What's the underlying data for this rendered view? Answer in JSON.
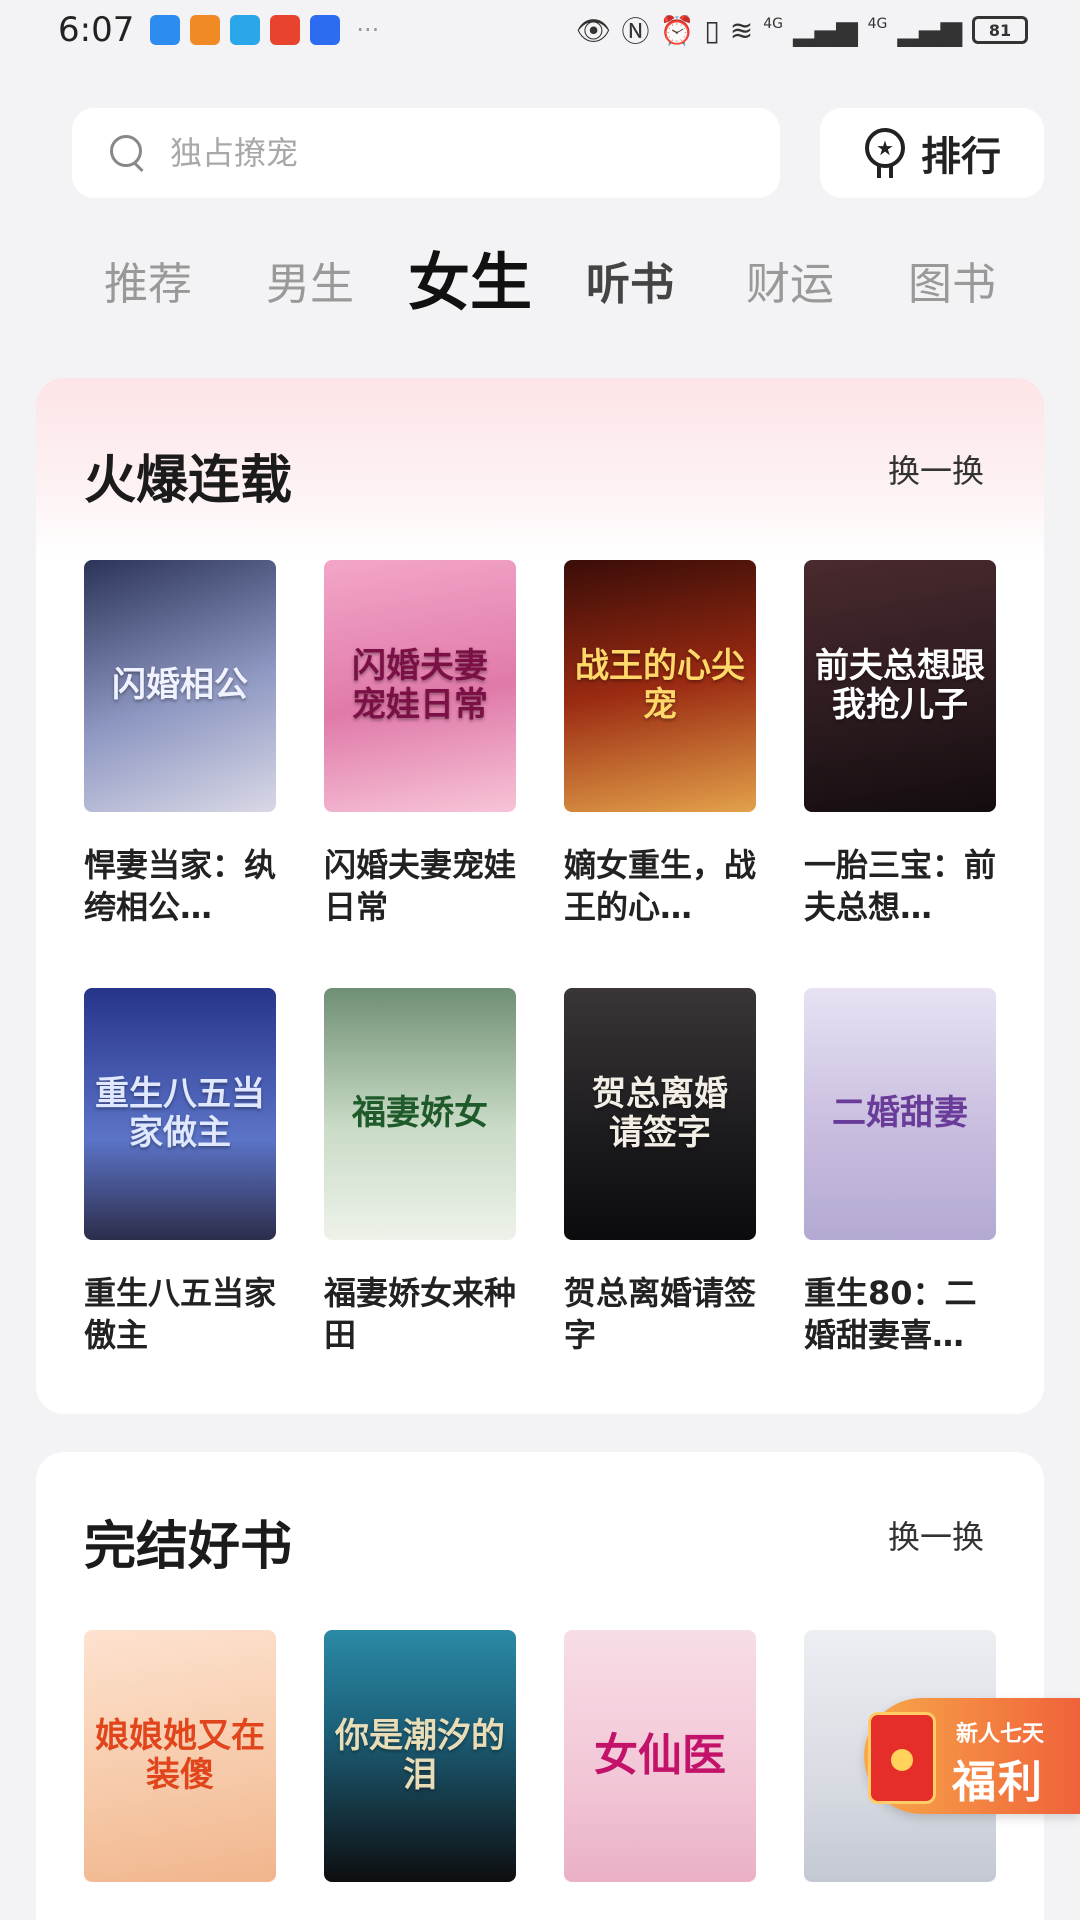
{
  "status_bar": {
    "time": "6:07",
    "dots": "···",
    "battery": "81",
    "network_1": "4G",
    "network_2": "4G",
    "notification_icons": [
      "#2d8cf0",
      "#f08a24",
      "#2aa7e8",
      "#e8432e",
      "#2d6cf0"
    ]
  },
  "search": {
    "placeholder": "独占撩宠"
  },
  "rank_button": {
    "label": "排行"
  },
  "tabs": [
    {
      "label": "推荐",
      "active": false
    },
    {
      "label": "男生",
      "active": false
    },
    {
      "label": "女生",
      "active": true
    },
    {
      "label": "听书",
      "active": false
    },
    {
      "label": "财运",
      "active": false
    },
    {
      "label": "图书",
      "active": false
    }
  ],
  "sections": {
    "hot": {
      "title": "火爆连载",
      "refresh_label": "换一换",
      "books": [
        {
          "title": "悍妻当家：纨绔相公…",
          "cover_text": "闪婚相公",
          "cover_color": "#6c7aa6"
        },
        {
          "title": "闪婚夫妻宠娃日常",
          "cover_text": "闪婚夫妻 宠娃日常",
          "cover_color": "#e48fb4"
        },
        {
          "title": "嫡女重生，战王的心…",
          "cover_text": "战王的心尖宠",
          "cover_color": "#8a3a20"
        },
        {
          "title": "一胎三宝：前夫总想…",
          "cover_text": "前夫总想跟我抢儿子",
          "cover_color": "#3a2228"
        },
        {
          "title": "重生八五当家傲主",
          "cover_text": "重生八五当家做主",
          "cover_color": "#3d4f9a"
        },
        {
          "title": "福妻娇女来种田",
          "cover_text": "福妻娇女",
          "cover_color": "#9fb8a0"
        },
        {
          "title": "贺总离婚请签字",
          "cover_text": "贺总离婚 请签字",
          "cover_color": "#1f1e22"
        },
        {
          "title": "重生80：二婚甜妻喜…",
          "cover_text": "二婚甜妻",
          "cover_color": "#c9bedf"
        }
      ]
    },
    "done": {
      "title": "完结好书",
      "refresh_label": "换一换",
      "books": [
        {
          "cover_text": "娘娘她又在装傻",
          "cover_color": "#f6c9a8"
        },
        {
          "cover_text": "你是潮汐的泪",
          "cover_color": "#1c5f78"
        },
        {
          "cover_text": "女仙医",
          "cover_color": "#f2c6d6"
        },
        {
          "cover_text": "",
          "cover_color": "#d8dbe2"
        }
      ]
    }
  },
  "welfare": {
    "top_line": "新人七天",
    "main_line": "福利"
  }
}
